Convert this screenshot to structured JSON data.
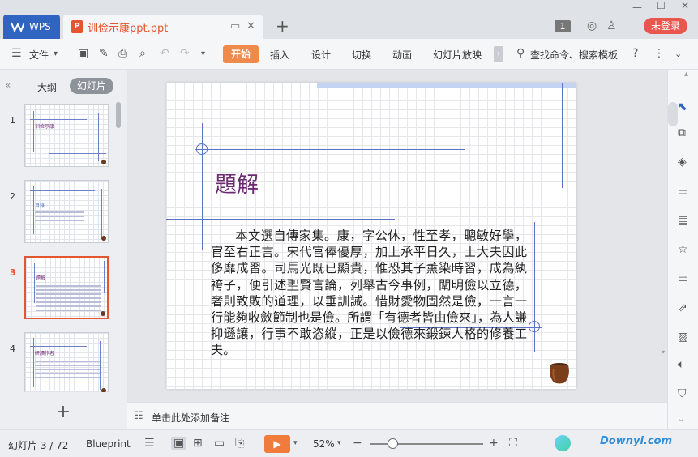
{
  "titlebar": {
    "wps_tab": "WPS",
    "doc_tab": "训俭示康ppt.ppt",
    "badge": "1",
    "login": "未登录"
  },
  "menubar": {
    "file": "文件",
    "start": "开始",
    "items": [
      "插入",
      "设计",
      "切换",
      "动画",
      "幻灯片放映"
    ],
    "search": "查找命令、搜索模板"
  },
  "leftpanel": {
    "tab_outline": "大纲",
    "tab_slides": "幻灯片",
    "thumbs": [
      {
        "num": "1",
        "title": "训俭示康"
      },
      {
        "num": "2",
        "title": "目錄"
      },
      {
        "num": "3",
        "title": "題解"
      },
      {
        "num": "4",
        "title": "研讀作者"
      }
    ],
    "active_index": 2
  },
  "slide": {
    "title": "題解",
    "body": "本文選自傳家集。康，字公休，性至孝，聰敏好學，官至右正言。宋代官俸優厚，加上承平日久，士大夫因此侈靡成習。司馬光既已顯貴，惟恐其子薰染時習，成為紈袴子，便引述聖賢言論，列舉古今事例，闡明儉以立德，奢則致敗的道理，以垂訓誡。惜財愛物固然是儉，一言一行能夠收斂節制也是儉。所謂「有德者皆由儉來」，為人謙抑遜讓，行事不敢恣縱，正是以儉德來鍛鍊人格的修養工夫。"
  },
  "notes": {
    "placeholder": "单击此处添加备注"
  },
  "statusbar": {
    "slide_counter": "幻灯片 3 / 72",
    "theme": "Blueprint",
    "zoom": "52%",
    "watermark": "Downyi.com",
    "zoom_value": 0.2
  },
  "colors": {
    "accent": "#e5552f",
    "title_color": "#6b2a72",
    "blueprint_line": "#5c72c4",
    "wps_blue": "#2f64c1"
  }
}
